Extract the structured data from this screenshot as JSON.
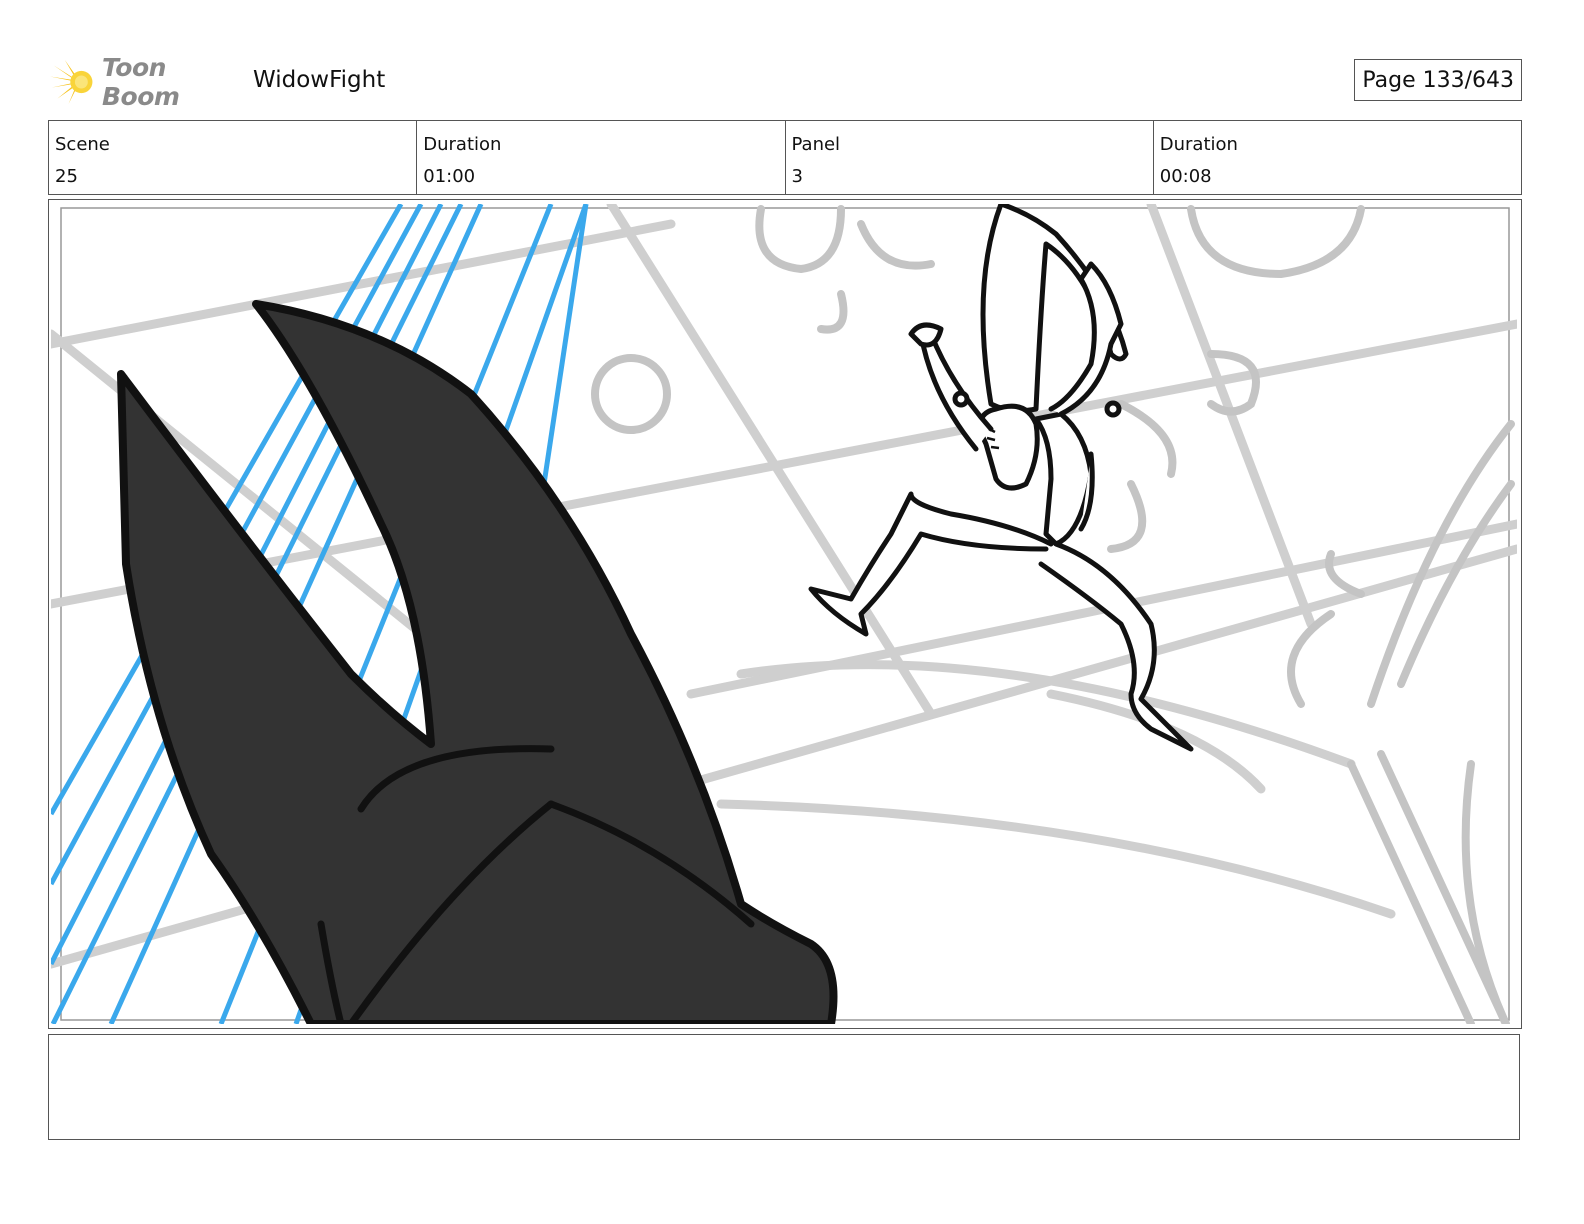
{
  "header": {
    "logo_text": "Toon Boom",
    "project_title": "WidowFight",
    "page_label": "Page 133/643"
  },
  "info": [
    {
      "label": "Scene",
      "value": "25"
    },
    {
      "label": "Duration",
      "value": "01:00"
    },
    {
      "label": "Panel",
      "value": "3"
    },
    {
      "label": "Duration",
      "value": "00:08"
    }
  ],
  "panel": {
    "image_description_icon": "storyboard-sketch",
    "colors": {
      "guide_blue": "#3aa8ec",
      "ear_fill": "#333333",
      "sketch_gray": "#c8c8c8"
    }
  },
  "notes": {
    "text": ""
  }
}
